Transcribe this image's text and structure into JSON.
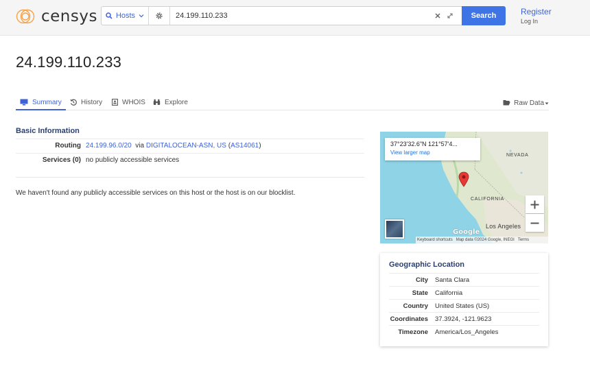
{
  "header": {
    "logo_text": "censys",
    "scope_label": "Hosts",
    "search_value": "24.199.110.233",
    "search_button": "Search",
    "register": "Register",
    "login": "Log In"
  },
  "page_title": "24.199.110.233",
  "tabs": [
    {
      "label": "Summary",
      "icon": "monitor-icon",
      "active": true
    },
    {
      "label": "History",
      "icon": "history-icon",
      "active": false
    },
    {
      "label": "WHOIS",
      "icon": "id-card-icon",
      "active": false
    },
    {
      "label": "Explore",
      "icon": "binoculars-icon",
      "active": false
    }
  ],
  "raw_data_label": "Raw Data",
  "basic_info": {
    "title": "Basic Information",
    "routing": {
      "key": "Routing",
      "prefix": "24.199.96.0/20",
      "via": "via",
      "asn_name": "DIGITALOCEAN-ASN, US",
      "asn_open": "(",
      "asn": "AS14061",
      "asn_close": ")"
    },
    "services": {
      "key": "Services (0)",
      "value": "no publicly accessible services"
    }
  },
  "notice": "We haven't found any publicly accessible services on this host or the host is on our blocklist.",
  "map": {
    "coords": "37°23'32.6\"N 121°57'4...",
    "larger_link": "View larger map",
    "label_nevada": "NEVADA",
    "label_california": "CALIFORNIA",
    "label_la": "Los Angeles",
    "google": "Google",
    "footer_shortcuts": "Keyboard shortcuts",
    "footer_data": "Map data ©2024 Google, INEGI",
    "footer_terms": "Terms"
  },
  "geo": {
    "title": "Geographic Location",
    "rows": [
      {
        "key": "City",
        "value": "Santa Clara"
      },
      {
        "key": "State",
        "value": "California"
      },
      {
        "key": "Country",
        "value": "United States (US)"
      },
      {
        "key": "Coordinates",
        "value": "37.3924, -121.9623"
      },
      {
        "key": "Timezone",
        "value": "America/Los_Angeles"
      }
    ]
  },
  "colors": {
    "accent": "#3f74e6",
    "link": "#3f63d6",
    "heading": "#2a3f70",
    "logo": "#f4a44a"
  }
}
